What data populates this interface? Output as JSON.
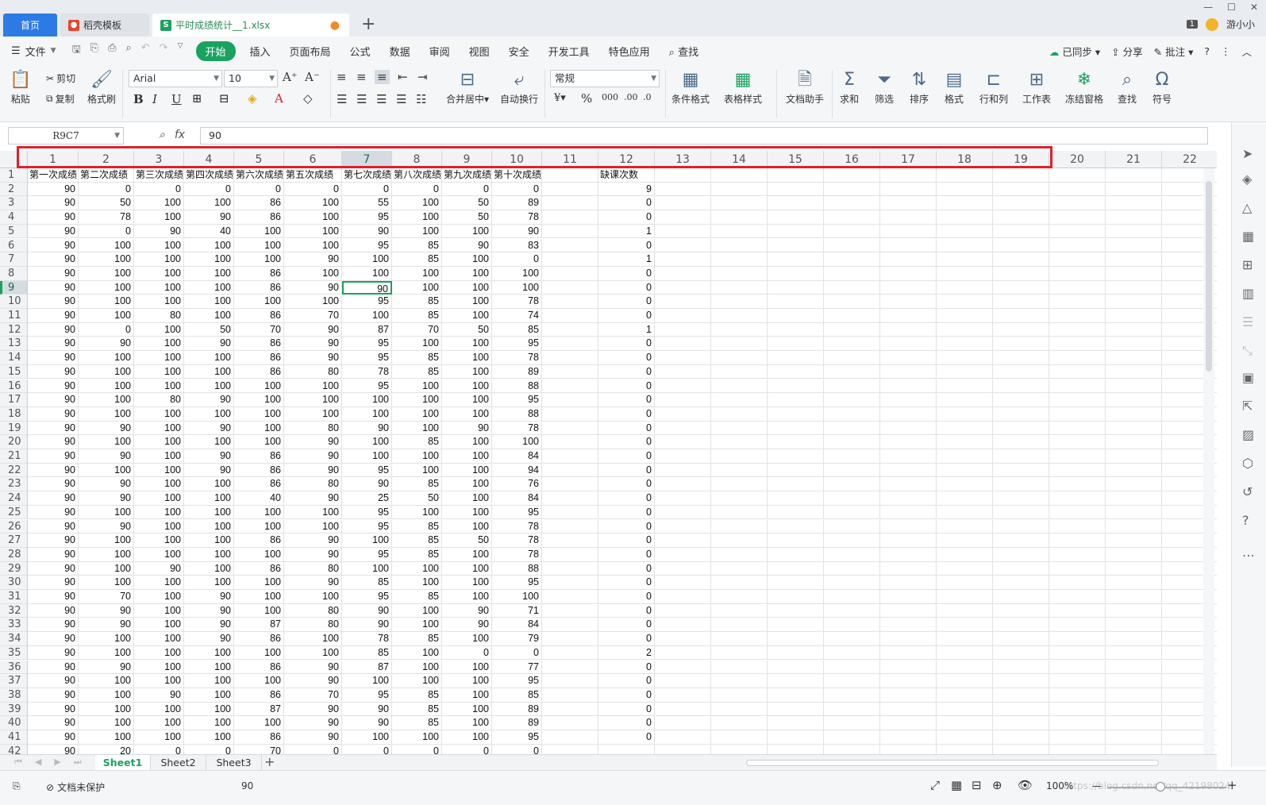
{
  "window": {
    "tabs": [
      {
        "label": "首页"
      },
      {
        "label": "稻壳模板"
      },
      {
        "label": "平时成绩统计__1.xlsx"
      }
    ],
    "badge": "1",
    "user": "游小小"
  },
  "menu": {
    "file": "文件",
    "items": [
      "开始",
      "插入",
      "页面布局",
      "公式",
      "数据",
      "审阅",
      "视图",
      "安全",
      "开发工具",
      "特色应用"
    ],
    "search": "查找",
    "sync": "已同步",
    "share": "分享",
    "comment": "批注"
  },
  "ribbon": {
    "paste": "粘贴",
    "cut": "剪切",
    "copy": "复制",
    "format_painter": "格式刷",
    "font": "Arial",
    "font_size": "10",
    "merge": "合并居中",
    "wrap": "自动换行",
    "number_format": "常规",
    "cond_format": "条件格式",
    "table_style": "表格样式",
    "doc_helper": "文档助手",
    "sum": "求和",
    "filter": "筛选",
    "sort": "排序",
    "format": "格式",
    "rowcol": "行和列",
    "worksheet": "工作表",
    "freeze": "冻结窗格",
    "find": "查找",
    "symbol": "符号"
  },
  "formula_bar": {
    "name_box": "R9C7",
    "fx": "fx",
    "value": "90"
  },
  "grid": {
    "columns": [
      "1",
      "2",
      "3",
      "4",
      "5",
      "6",
      "7",
      "8",
      "9",
      "10",
      "11",
      "12",
      "13",
      "14",
      "15",
      "16",
      "17",
      "18",
      "19",
      "20",
      "21",
      "22"
    ],
    "selected_column": "7",
    "selected_row": "9",
    "header_row": [
      "第一次成绩",
      "第二次成绩",
      "第三次成绩",
      "第四次成绩",
      "第六次成绩",
      "第五次成绩",
      "第七次成绩",
      "第八次成绩",
      "第九次成绩",
      "第十次成绩",
      "",
      "缺课次数"
    ],
    "rows": [
      [
        "90",
        "0",
        "0",
        "0",
        "0",
        "0",
        "0",
        "0",
        "0",
        "0",
        "",
        "9"
      ],
      [
        "90",
        "50",
        "100",
        "100",
        "86",
        "100",
        "55",
        "100",
        "50",
        "89",
        "",
        "0"
      ],
      [
        "90",
        "78",
        "100",
        "90",
        "86",
        "100",
        "95",
        "100",
        "50",
        "78",
        "",
        "0"
      ],
      [
        "90",
        "0",
        "90",
        "40",
        "100",
        "100",
        "90",
        "100",
        "100",
        "90",
        "",
        "1"
      ],
      [
        "90",
        "100",
        "100",
        "100",
        "100",
        "100",
        "95",
        "85",
        "90",
        "83",
        "",
        "0"
      ],
      [
        "90",
        "100",
        "100",
        "100",
        "100",
        "90",
        "100",
        "85",
        "100",
        "0",
        "",
        "1"
      ],
      [
        "90",
        "100",
        "100",
        "100",
        "86",
        "100",
        "100",
        "100",
        "100",
        "100",
        "",
        "0"
      ],
      [
        "90",
        "100",
        "100",
        "100",
        "86",
        "90",
        "90",
        "100",
        "100",
        "100",
        "",
        "0"
      ],
      [
        "90",
        "100",
        "100",
        "100",
        "100",
        "100",
        "95",
        "85",
        "100",
        "78",
        "",
        "0"
      ],
      [
        "90",
        "100",
        "80",
        "100",
        "86",
        "70",
        "100",
        "85",
        "100",
        "74",
        "",
        "0"
      ],
      [
        "90",
        "0",
        "100",
        "50",
        "70",
        "90",
        "87",
        "70",
        "50",
        "85",
        "",
        "1"
      ],
      [
        "90",
        "90",
        "100",
        "90",
        "86",
        "90",
        "95",
        "100",
        "100",
        "95",
        "",
        "0"
      ],
      [
        "90",
        "100",
        "100",
        "100",
        "86",
        "90",
        "95",
        "85",
        "100",
        "78",
        "",
        "0"
      ],
      [
        "90",
        "100",
        "100",
        "100",
        "86",
        "80",
        "78",
        "85",
        "100",
        "89",
        "",
        "0"
      ],
      [
        "90",
        "100",
        "100",
        "100",
        "100",
        "100",
        "95",
        "100",
        "100",
        "88",
        "",
        "0"
      ],
      [
        "90",
        "100",
        "80",
        "90",
        "100",
        "100",
        "100",
        "100",
        "100",
        "95",
        "",
        "0"
      ],
      [
        "90",
        "100",
        "100",
        "100",
        "100",
        "100",
        "100",
        "100",
        "100",
        "88",
        "",
        "0"
      ],
      [
        "90",
        "90",
        "100",
        "90",
        "100",
        "80",
        "90",
        "100",
        "90",
        "78",
        "",
        "0"
      ],
      [
        "90",
        "100",
        "100",
        "100",
        "100",
        "90",
        "100",
        "85",
        "100",
        "100",
        "",
        "0"
      ],
      [
        "90",
        "90",
        "100",
        "90",
        "86",
        "90",
        "100",
        "100",
        "100",
        "84",
        "",
        "0"
      ],
      [
        "90",
        "100",
        "100",
        "90",
        "86",
        "90",
        "95",
        "100",
        "100",
        "94",
        "",
        "0"
      ],
      [
        "90",
        "90",
        "100",
        "100",
        "86",
        "80",
        "90",
        "85",
        "100",
        "76",
        "",
        "0"
      ],
      [
        "90",
        "90",
        "100",
        "100",
        "40",
        "90",
        "25",
        "50",
        "100",
        "84",
        "",
        "0"
      ],
      [
        "90",
        "100",
        "100",
        "100",
        "100",
        "100",
        "95",
        "100",
        "100",
        "95",
        "",
        "0"
      ],
      [
        "90",
        "90",
        "100",
        "100",
        "100",
        "100",
        "95",
        "85",
        "100",
        "78",
        "",
        "0"
      ],
      [
        "90",
        "100",
        "100",
        "100",
        "86",
        "90",
        "100",
        "85",
        "50",
        "78",
        "",
        "0"
      ],
      [
        "90",
        "100",
        "100",
        "100",
        "100",
        "90",
        "95",
        "85",
        "100",
        "78",
        "",
        "0"
      ],
      [
        "90",
        "100",
        "90",
        "100",
        "86",
        "80",
        "100",
        "100",
        "100",
        "88",
        "",
        "0"
      ],
      [
        "90",
        "100",
        "100",
        "100",
        "100",
        "90",
        "85",
        "100",
        "100",
        "95",
        "",
        "0"
      ],
      [
        "90",
        "70",
        "100",
        "90",
        "100",
        "100",
        "95",
        "85",
        "100",
        "100",
        "",
        "0"
      ],
      [
        "90",
        "90",
        "100",
        "90",
        "100",
        "80",
        "90",
        "100",
        "90",
        "71",
        "",
        "0"
      ],
      [
        "90",
        "90",
        "100",
        "90",
        "87",
        "80",
        "90",
        "100",
        "90",
        "84",
        "",
        "0"
      ],
      [
        "90",
        "100",
        "100",
        "90",
        "86",
        "100",
        "78",
        "85",
        "100",
        "79",
        "",
        "0"
      ],
      [
        "90",
        "100",
        "100",
        "100",
        "100",
        "100",
        "85",
        "100",
        "0",
        "0",
        "",
        "2"
      ],
      [
        "90",
        "90",
        "100",
        "100",
        "86",
        "90",
        "87",
        "100",
        "100",
        "77",
        "",
        "0"
      ],
      [
        "90",
        "100",
        "100",
        "100",
        "100",
        "90",
        "100",
        "100",
        "100",
        "95",
        "",
        "0"
      ],
      [
        "90",
        "100",
        "90",
        "100",
        "86",
        "70",
        "95",
        "85",
        "100",
        "85",
        "",
        "0"
      ],
      [
        "90",
        "100",
        "100",
        "100",
        "87",
        "90",
        "90",
        "85",
        "100",
        "89",
        "",
        "0"
      ],
      [
        "90",
        "100",
        "100",
        "100",
        "100",
        "90",
        "90",
        "85",
        "100",
        "89",
        "",
        "0"
      ],
      [
        "90",
        "100",
        "100",
        "100",
        "86",
        "90",
        "100",
        "100",
        "100",
        "95",
        "",
        "0"
      ],
      [
        "90",
        "20",
        "0",
        "0",
        "70",
        "0",
        "0",
        "0",
        "0",
        "0",
        "",
        ""
      ]
    ]
  },
  "sheets": [
    "Sheet1",
    "Sheet2",
    "Sheet3"
  ],
  "status": {
    "protect": "文档未保护",
    "value": "90",
    "zoom": "100%",
    "watermark": "https://blog.csdn.net/qq_42198024"
  }
}
